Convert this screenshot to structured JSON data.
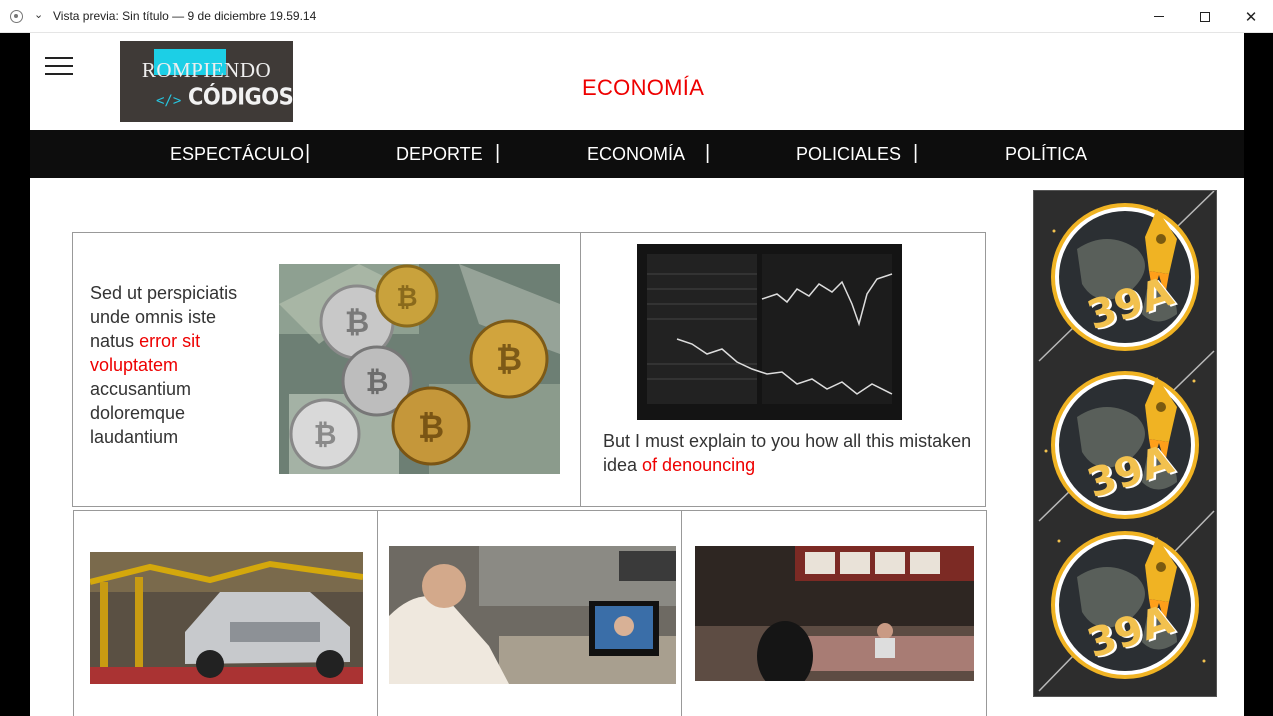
{
  "window": {
    "title": "Vista previa: Sin título — 9 de diciembre 19.59.14"
  },
  "header": {
    "logo_top": "ROMPIENDO",
    "logo_code": "</>",
    "logo_bottom": "CÓDIGOS",
    "section_title": "ECONOMÍA"
  },
  "nav": {
    "items": [
      {
        "label": "ESPECTÁCULO"
      },
      {
        "label": "DEPORTE"
      },
      {
        "label": "ECONOMÍA"
      },
      {
        "label": "POLICIALES"
      },
      {
        "label": "POLÍTICA"
      }
    ],
    "separator": "|"
  },
  "articles": {
    "first": {
      "text_before": "Sed ut perspiciatis unde omnis iste natus",
      "text_highlight": "error sit voluptatem",
      "text_after": "accusantium doloremque laudantium"
    },
    "second": {
      "text_before": "But I must explain to you how all this mistaken idea",
      "text_highlight": "of denouncing"
    }
  },
  "ad": {
    "badge_text": "39A"
  },
  "colors": {
    "accent": "#ee0000",
    "navbar": "#0d0d0d",
    "logo_bg": "#3f3a37",
    "logo_highlight": "#1ccfe6"
  }
}
